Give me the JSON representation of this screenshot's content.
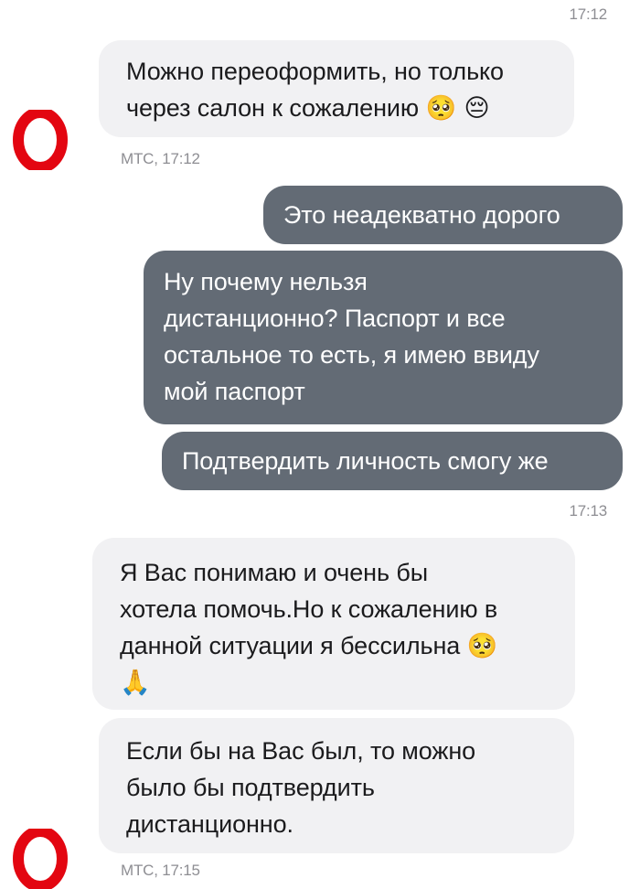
{
  "chat": {
    "ts_top": "17:12",
    "msg1_line1": "Можно переоформить, но только",
    "msg1_line2": "через салон к сожалению",
    "msg1_emoji": "🥺 😔",
    "msg1_meta": "МТС, 17:12",
    "out1": "Это неадекватно дорого",
    "out2_line1": "Ну почему нельзя",
    "out2_line2": "дистанционно? Паспорт и все",
    "out2_line3": "остальное то есть, я имею ввиду",
    "out2_line4": "мой паспорт",
    "out3": "Подтвердить личность смогу же",
    "ts_mid": "17:13",
    "msg2_line1": "Я Вас понимаю и очень бы",
    "msg2_line2": "хотела помочь.Но к сожалению в",
    "msg2_line3": "данной ситуации я бессильна",
    "msg2_emoji": "🥺",
    "msg2_emoji2": "🙏",
    "msg3_line1": "Если бы на Вас был, то можно",
    "msg3_line2": "было бы подтвердить",
    "msg3_line3": "дистанционно.",
    "msg3_meta": "МТС, 17:15"
  },
  "colors": {
    "incoming_bubble": "#f1f1f3",
    "outgoing_bubble": "#636b75",
    "brand_red": "#e30611"
  },
  "icons": {
    "avatar": "mts-logo-icon"
  }
}
